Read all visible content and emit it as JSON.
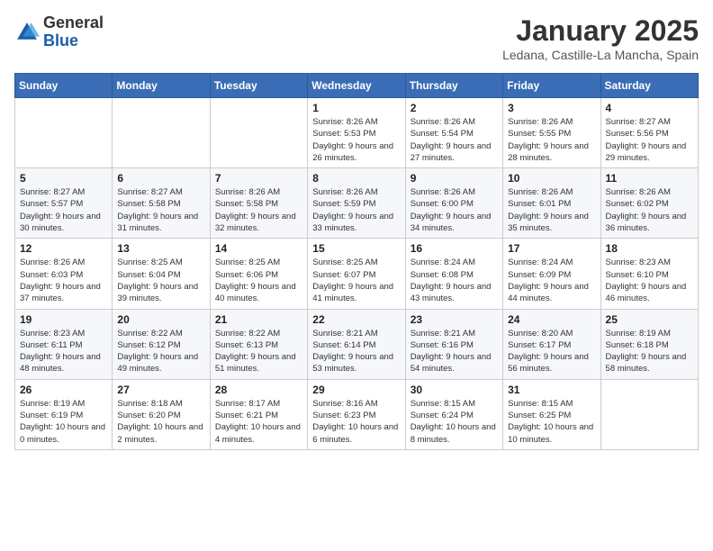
{
  "logo": {
    "general": "General",
    "blue": "Blue"
  },
  "header": {
    "month": "January 2025",
    "location": "Ledana, Castille-La Mancha, Spain"
  },
  "weekdays": [
    "Sunday",
    "Monday",
    "Tuesday",
    "Wednesday",
    "Thursday",
    "Friday",
    "Saturday"
  ],
  "weeks": [
    [
      {
        "day": "",
        "info": ""
      },
      {
        "day": "",
        "info": ""
      },
      {
        "day": "",
        "info": ""
      },
      {
        "day": "1",
        "info": "Sunrise: 8:26 AM\nSunset: 5:53 PM\nDaylight: 9 hours and 26 minutes."
      },
      {
        "day": "2",
        "info": "Sunrise: 8:26 AM\nSunset: 5:54 PM\nDaylight: 9 hours and 27 minutes."
      },
      {
        "day": "3",
        "info": "Sunrise: 8:26 AM\nSunset: 5:55 PM\nDaylight: 9 hours and 28 minutes."
      },
      {
        "day": "4",
        "info": "Sunrise: 8:27 AM\nSunset: 5:56 PM\nDaylight: 9 hours and 29 minutes."
      }
    ],
    [
      {
        "day": "5",
        "info": "Sunrise: 8:27 AM\nSunset: 5:57 PM\nDaylight: 9 hours and 30 minutes."
      },
      {
        "day": "6",
        "info": "Sunrise: 8:27 AM\nSunset: 5:58 PM\nDaylight: 9 hours and 31 minutes."
      },
      {
        "day": "7",
        "info": "Sunrise: 8:26 AM\nSunset: 5:58 PM\nDaylight: 9 hours and 32 minutes."
      },
      {
        "day": "8",
        "info": "Sunrise: 8:26 AM\nSunset: 5:59 PM\nDaylight: 9 hours and 33 minutes."
      },
      {
        "day": "9",
        "info": "Sunrise: 8:26 AM\nSunset: 6:00 PM\nDaylight: 9 hours and 34 minutes."
      },
      {
        "day": "10",
        "info": "Sunrise: 8:26 AM\nSunset: 6:01 PM\nDaylight: 9 hours and 35 minutes."
      },
      {
        "day": "11",
        "info": "Sunrise: 8:26 AM\nSunset: 6:02 PM\nDaylight: 9 hours and 36 minutes."
      }
    ],
    [
      {
        "day": "12",
        "info": "Sunrise: 8:26 AM\nSunset: 6:03 PM\nDaylight: 9 hours and 37 minutes."
      },
      {
        "day": "13",
        "info": "Sunrise: 8:25 AM\nSunset: 6:04 PM\nDaylight: 9 hours and 39 minutes."
      },
      {
        "day": "14",
        "info": "Sunrise: 8:25 AM\nSunset: 6:06 PM\nDaylight: 9 hours and 40 minutes."
      },
      {
        "day": "15",
        "info": "Sunrise: 8:25 AM\nSunset: 6:07 PM\nDaylight: 9 hours and 41 minutes."
      },
      {
        "day": "16",
        "info": "Sunrise: 8:24 AM\nSunset: 6:08 PM\nDaylight: 9 hours and 43 minutes."
      },
      {
        "day": "17",
        "info": "Sunrise: 8:24 AM\nSunset: 6:09 PM\nDaylight: 9 hours and 44 minutes."
      },
      {
        "day": "18",
        "info": "Sunrise: 8:23 AM\nSunset: 6:10 PM\nDaylight: 9 hours and 46 minutes."
      }
    ],
    [
      {
        "day": "19",
        "info": "Sunrise: 8:23 AM\nSunset: 6:11 PM\nDaylight: 9 hours and 48 minutes."
      },
      {
        "day": "20",
        "info": "Sunrise: 8:22 AM\nSunset: 6:12 PM\nDaylight: 9 hours and 49 minutes."
      },
      {
        "day": "21",
        "info": "Sunrise: 8:22 AM\nSunset: 6:13 PM\nDaylight: 9 hours and 51 minutes."
      },
      {
        "day": "22",
        "info": "Sunrise: 8:21 AM\nSunset: 6:14 PM\nDaylight: 9 hours and 53 minutes."
      },
      {
        "day": "23",
        "info": "Sunrise: 8:21 AM\nSunset: 6:16 PM\nDaylight: 9 hours and 54 minutes."
      },
      {
        "day": "24",
        "info": "Sunrise: 8:20 AM\nSunset: 6:17 PM\nDaylight: 9 hours and 56 minutes."
      },
      {
        "day": "25",
        "info": "Sunrise: 8:19 AM\nSunset: 6:18 PM\nDaylight: 9 hours and 58 minutes."
      }
    ],
    [
      {
        "day": "26",
        "info": "Sunrise: 8:19 AM\nSunset: 6:19 PM\nDaylight: 10 hours and 0 minutes."
      },
      {
        "day": "27",
        "info": "Sunrise: 8:18 AM\nSunset: 6:20 PM\nDaylight: 10 hours and 2 minutes."
      },
      {
        "day": "28",
        "info": "Sunrise: 8:17 AM\nSunset: 6:21 PM\nDaylight: 10 hours and 4 minutes."
      },
      {
        "day": "29",
        "info": "Sunrise: 8:16 AM\nSunset: 6:23 PM\nDaylight: 10 hours and 6 minutes."
      },
      {
        "day": "30",
        "info": "Sunrise: 8:15 AM\nSunset: 6:24 PM\nDaylight: 10 hours and 8 minutes."
      },
      {
        "day": "31",
        "info": "Sunrise: 8:15 AM\nSunset: 6:25 PM\nDaylight: 10 hours and 10 minutes."
      },
      {
        "day": "",
        "info": ""
      }
    ]
  ]
}
